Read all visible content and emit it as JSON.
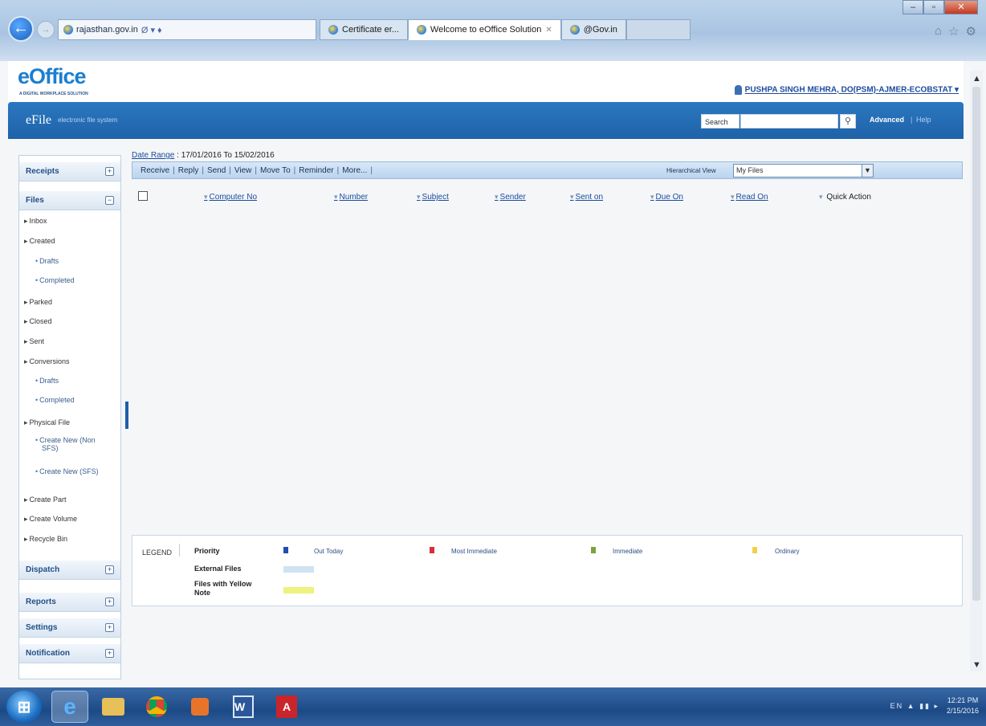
{
  "browser": {
    "address_host": "rajasthan.gov.in",
    "address_suffix": "Ø ▾ ♦",
    "tabs": [
      {
        "label": "Certificate er..."
      },
      {
        "label": "Welcome to eOffice Solution"
      },
      {
        "label": "@Gov.in"
      }
    ]
  },
  "header": {
    "logo": "eOffice",
    "logo_sub": "A DIGITAL WORKPLACE SOLUTION",
    "user": "PUSHPA SINGH MEHRA, DO(PSM)-AJMER-ECOBSTAT",
    "user_arrow": "▾"
  },
  "banner": {
    "title": "eFile",
    "subtitle": "electronic file system",
    "search_label": "Search",
    "search_placeholder": "",
    "advanced": "Advanced",
    "sep": "|",
    "help": "Help"
  },
  "sidebar": {
    "sections": [
      {
        "label": "Receipts",
        "toggle": "+"
      },
      {
        "label": "Files",
        "toggle": "−"
      },
      {
        "label": "Dispatch",
        "toggle": "+"
      },
      {
        "label": "Reports",
        "toggle": "+"
      },
      {
        "label": "Settings",
        "toggle": "+"
      },
      {
        "label": "Notification",
        "toggle": "+"
      }
    ],
    "items": [
      "Inbox",
      "Created",
      "Drafts",
      "Completed",
      "Parked",
      "Closed",
      "Sent",
      "Conversions",
      "Drafts",
      "Completed",
      "Physical File",
      "Create New (Non",
      "SFS)",
      "Create New (SFS)",
      "Create Part",
      "Create Volume",
      "Recycle Bin"
    ]
  },
  "date_range": {
    "label": "Date Range",
    "value": ": 17/01/2016 To 15/02/2016"
  },
  "toolbar": {
    "actions": [
      "Receive",
      "Reply",
      "Send",
      "View",
      "Move To",
      "Reminder",
      "More..."
    ],
    "hierarchical_label": "Hierarchical View",
    "hierarchical_value": "My Files"
  },
  "columns": [
    "Computer No",
    "Number",
    "Subject",
    "Sender",
    "Sent on",
    "Due On",
    "Read On",
    "Quick Action"
  ],
  "legend": {
    "title": "LEGEND",
    "priority_label": "Priority",
    "priorities": [
      {
        "label": "Out Today",
        "color": "#1f4fb0"
      },
      {
        "label": "Most Immediate",
        "color": "#d62f3a"
      },
      {
        "label": "Immediate",
        "color": "#7aa33a"
      },
      {
        "label": "Ordinary",
        "color": "#f2d14a"
      }
    ],
    "external_label": "External Files",
    "external_color": "#cfe3f2",
    "yellow_label_1": "Files with Yellow",
    "yellow_label_2": "Note",
    "yellow_color": "#eef27e"
  },
  "taskbar": {
    "tray": "EN ▲ ▮▮ ▸",
    "time": "12:21 PM",
    "date": "2/15/2016",
    "word_label": "W",
    "pdf_label": "A"
  }
}
